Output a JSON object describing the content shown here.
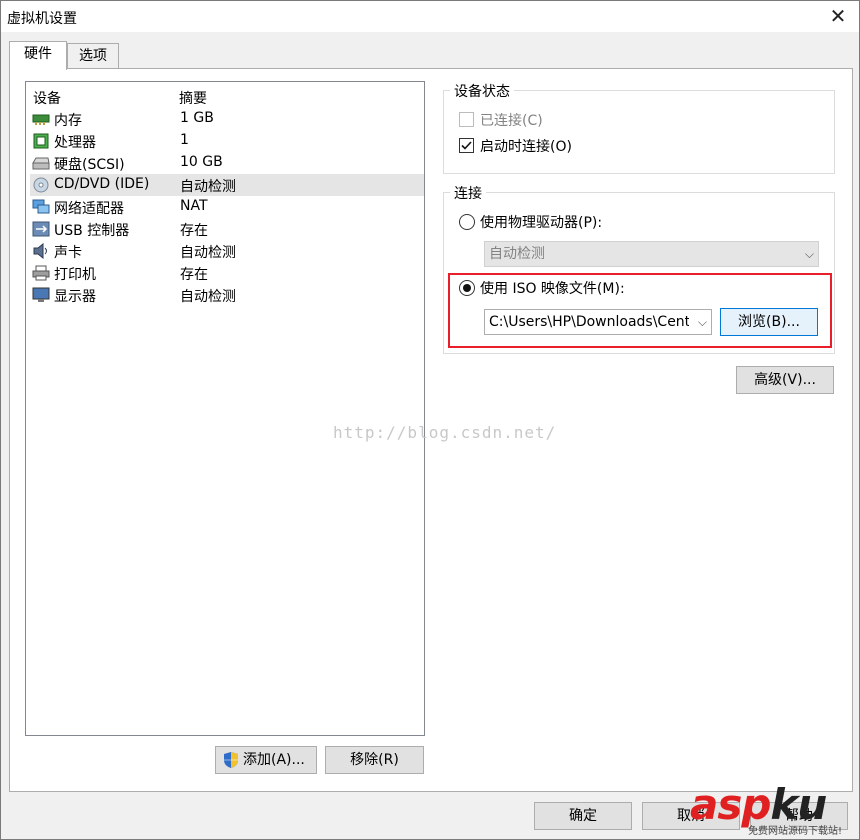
{
  "window": {
    "title": "虚拟机设置",
    "close_symbol": "✕"
  },
  "tabs": [
    {
      "label": "硬件"
    },
    {
      "label": "选项"
    }
  ],
  "device_list": {
    "col_device": "设备",
    "col_summary": "摘要",
    "rows": [
      {
        "name": "内存",
        "summary": "1 GB",
        "icon": "memory-icon"
      },
      {
        "name": "处理器",
        "summary": "1",
        "icon": "processor-icon"
      },
      {
        "name": "硬盘(SCSI)",
        "summary": "10 GB",
        "icon": "hard-disk-icon"
      },
      {
        "name": "CD/DVD (IDE)",
        "summary": "自动检测",
        "icon": "cd-dvd-icon",
        "selected": true
      },
      {
        "name": "网络适配器",
        "summary": "NAT",
        "icon": "network-adapter-icon"
      },
      {
        "name": "USB 控制器",
        "summary": "存在",
        "icon": "usb-icon"
      },
      {
        "name": "声卡",
        "summary": "自动检测",
        "icon": "sound-card-icon"
      },
      {
        "name": "打印机",
        "summary": "存在",
        "icon": "printer-icon"
      },
      {
        "name": "显示器",
        "summary": "自动检测",
        "icon": "display-icon"
      }
    ]
  },
  "buttons": {
    "add": "添加(A)...",
    "remove": "移除(R)",
    "ok": "确定",
    "cancel": "取消",
    "help": "帮助",
    "browse": "浏览(B)...",
    "advanced": "高级(V)..."
  },
  "device_status": {
    "label": "设备状态",
    "connected": {
      "label": "已连接(C)",
      "checked": false,
      "disabled": true
    },
    "connect_at_power_on": {
      "label": "启动时连接(O)",
      "checked": true
    }
  },
  "connection": {
    "label": "连接",
    "physical_drive": {
      "label": "使用物理驱动器(P):",
      "selected": false,
      "value": "自动检测"
    },
    "iso_image": {
      "label": "使用 ISO 映像文件(M):",
      "selected": true,
      "value": "C:\\Users\\HP\\Downloads\\CentOS"
    }
  },
  "watermark": "http://blog.csdn.net/",
  "brand": {
    "asp": "asp",
    "ku": "ku",
    "sub": "免费网站源码下载站!"
  },
  "colors": {
    "highlight_box": "#e81f2a",
    "selected_row": "#e5e5e5",
    "focus_border": "#0078d7"
  }
}
